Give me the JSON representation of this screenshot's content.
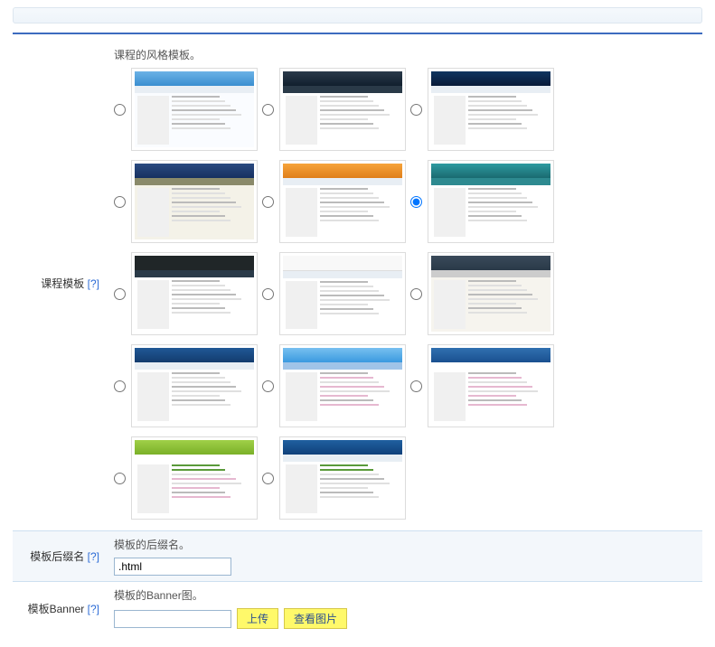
{
  "sections": {
    "template": {
      "label": "课程模板",
      "help": "[?]",
      "desc": "课程的风格模板。",
      "selected_index": 5
    },
    "suffix": {
      "label": "模板后缀名",
      "help": "[?]",
      "desc": "模板的后缀名。",
      "value": ".html"
    },
    "banner": {
      "label": "模板Banner",
      "help": "[?]",
      "desc": "模板的Banner图。",
      "value": "",
      "upload_label": "上传",
      "view_label": "查看图片"
    }
  },
  "templates": [
    {
      "id": 0,
      "header": "h-blue-sky",
      "nav": "n-light",
      "body_bg": "#fafcff"
    },
    {
      "id": 1,
      "header": "h-dark",
      "nav": "n-dark",
      "body_bg": "#ffffff"
    },
    {
      "id": 2,
      "header": "h-globe",
      "nav": "n-light",
      "body_bg": "#ffffff"
    },
    {
      "id": 3,
      "header": "h-navy",
      "nav": "n-olive",
      "body_bg": "#f4f2e8"
    },
    {
      "id": 4,
      "header": "h-orange",
      "nav": "n-light",
      "body_bg": "#ffffff"
    },
    {
      "id": 5,
      "header": "h-teal",
      "nav": "n-teal",
      "body_bg": "#ffffff"
    },
    {
      "id": 6,
      "header": "h-black",
      "nav": "n-dark",
      "body_bg": "#ffffff"
    },
    {
      "id": 7,
      "header": "h-white",
      "nav": "n-light",
      "body_bg": "#ffffff",
      "leaf": true
    },
    {
      "id": 8,
      "header": "h-slate",
      "nav": "n-gray",
      "body_bg": "#f6f4ee"
    },
    {
      "id": 9,
      "header": "h-blue2",
      "nav": "n-light",
      "body_bg": "#ffffff"
    },
    {
      "id": 10,
      "header": "h-sky2",
      "nav": "n-blue",
      "body_bg": "#ffffff",
      "pink": true
    },
    {
      "id": 11,
      "header": "h-blue3",
      "nav": "n-none",
      "body_bg": "#ffffff",
      "pink": true
    },
    {
      "id": 12,
      "header": "h-green",
      "nav": "n-none",
      "body_bg": "#ffffff",
      "pink": true,
      "green_lines": true
    },
    {
      "id": 13,
      "header": "h-blue4",
      "nav": "n-light",
      "body_bg": "#ffffff",
      "green_lines": true
    }
  ]
}
